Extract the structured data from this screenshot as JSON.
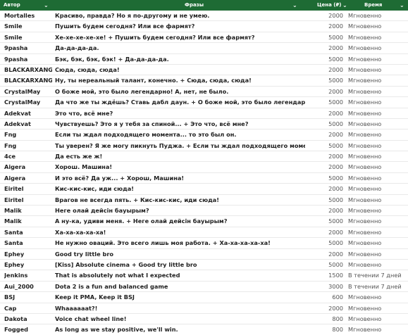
{
  "header": {
    "author": "Автор",
    "phrases": "Фразы",
    "price": "Цена (₽)",
    "time": "Время отправки"
  },
  "rows": [
    {
      "author": "Mortalles",
      "phrase": "Красиво, правда? Но я по-другому и не умею.",
      "price": "2000",
      "time": "Мгновенно"
    },
    {
      "author": "Smile",
      "phrase": "Пушить будем сегодня? Или все фармят?",
      "price": "2000",
      "time": "Мгновенно"
    },
    {
      "author": "Smile",
      "phrase": "Хе-хе-хе-хе-хе! + Пушить будем сегодня? Или все фармят?",
      "price": "5000",
      "time": "Мгновенно"
    },
    {
      "author": "9pasha",
      "phrase": "Да-да-да-да.",
      "price": "2000",
      "time": "Мгновенно"
    },
    {
      "author": "9pasha",
      "phrase": "Бэк, бэк, бэк, бэк! + Да-да-да-да.",
      "price": "5000",
      "time": "Мгновенно"
    },
    {
      "author": "BLACKARXANGEL",
      "phrase": "Сюда, сюда, сюда!",
      "price": "2000",
      "time": "Мгновенно"
    },
    {
      "author": "BLACKARXANGEL",
      "phrase": "Ну, ты нереальный талант, конечно. + Сюда, сюда, сюда!",
      "price": "5000",
      "time": "Мгновенно"
    },
    {
      "author": "CrystalMay",
      "phrase": "О боже мой, это было легендарно! А, нет, не было.",
      "price": "2000",
      "time": "Мгновенно"
    },
    {
      "author": "CrystalMay",
      "phrase": "Да что же ты ждёшь? Ставь дабл даун. + О боже мой, это было легендарно! А, нет, не б",
      "price": "5000",
      "time": "Мгновенно"
    },
    {
      "author": "Adekvat",
      "phrase": "Это что, всё мне?",
      "price": "2000",
      "time": "Мгновенно"
    },
    {
      "author": "Adekvat",
      "phrase": "Чувствуешь? Это я у тебя за спиной... + Это что, всё мне?",
      "price": "5000",
      "time": "Мгновенно"
    },
    {
      "author": "Fng",
      "phrase": "Если ты ждал подходящего момента... то это был он.",
      "price": "2000",
      "time": "Мгновенно"
    },
    {
      "author": "Fng",
      "phrase": "Ты уверен? Я же могу пикнуть Пуджа. + Если ты ждал подходящего момента... то это",
      "price": "5000",
      "time": "Мгновенно"
    },
    {
      "author": "4ce",
      "phrase": "Да есть же ж!",
      "price": "2000",
      "time": "Мгновенно"
    },
    {
      "author": "Aigera",
      "phrase": "Хорош. Машина!",
      "price": "2000",
      "time": "Мгновенно"
    },
    {
      "author": "Aigera",
      "phrase": "И это всё? Да уж... + Хорош, Машина!",
      "price": "5000",
      "time": "Мгновенно"
    },
    {
      "author": "Eiritel",
      "phrase": "Кис-кис-кис, иди сюда!",
      "price": "2000",
      "time": "Мгновенно"
    },
    {
      "author": "Eiritel",
      "phrase": "Врагов не всегда пять. + Кис-кис-кис, иди сюда!",
      "price": "5000",
      "time": "Мгновенно"
    },
    {
      "author": "Malik",
      "phrase": "Неге олай дейсін бауырым?",
      "price": "2000",
      "time": "Мгновенно"
    },
    {
      "author": "Malik",
      "phrase": "А ну-ка, удиви меня. + Неге олай дейсін бауырым?",
      "price": "5000",
      "time": "Мгновенно"
    },
    {
      "author": "Santa",
      "phrase": "Ха-ха-ха-ха-ха!",
      "price": "2000",
      "time": "Мгновенно"
    },
    {
      "author": "Santa",
      "phrase": "Не нужно оваций. Это всего лишь моя работа. + Ха-ха-ха-ха-ха!",
      "price": "5000",
      "time": "Мгновенно"
    },
    {
      "author": "Ephey",
      "phrase": "Good try little bro",
      "price": "2000",
      "time": "Мгновенно"
    },
    {
      "author": "Ephey",
      "phrase": "[Kiss] Absolute cinema + Good try little bro",
      "price": "5000",
      "time": "Мгновенно"
    },
    {
      "author": "Jenkins",
      "phrase": "That is absolutely not what I expected",
      "price": "1500",
      "time": "В течении 7 дней"
    },
    {
      "author": "Aui_2000",
      "phrase": "Dota 2 is a fun and balanced game",
      "price": "3000",
      "time": "В течении 7 дней"
    },
    {
      "author": "BSJ",
      "phrase": "Keep it PMA, Keep it BSJ",
      "price": "600",
      "time": "Мгновенно"
    },
    {
      "author": "Cap",
      "phrase": "Whaaaaaat?!",
      "price": "2000",
      "time": "Мгновенно"
    },
    {
      "author": "Dakota",
      "phrase": "Voice chat wheel line!",
      "price": "800",
      "time": "Мгновенно"
    },
    {
      "author": "Fogged",
      "phrase": "As long as we stay positive, we'll win.",
      "price": "800",
      "time": "Мгновенно"
    },
    {
      "author": "Frankie",
      "phrase": "Yay me!",
      "price": "1000",
      "time": "В течении 7 дней"
    }
  ]
}
